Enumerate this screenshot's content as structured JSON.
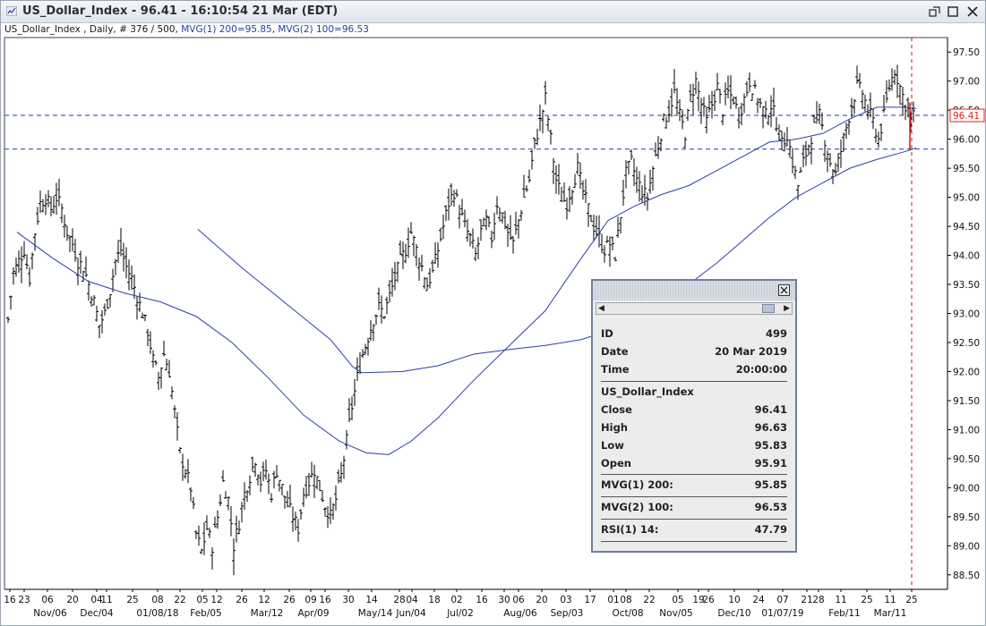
{
  "window": {
    "title": "US_Dollar_Index - 96.41 - 16:10:54  21 Mar (EDT)",
    "controls": [
      "restore-icon",
      "maximize-icon",
      "close-icon"
    ]
  },
  "info_line": {
    "instrument": "US_Dollar_Index , Daily, # 376 / 500, ",
    "mvg1": "MVG(1) 200=95.85",
    "separator": ", ",
    "mvg2": "MVG(2) 100=96.53"
  },
  "popup": {
    "rows": [
      {
        "key": "ID",
        "value": "499"
      },
      {
        "key": "Date",
        "value": "20 Mar 2019"
      },
      {
        "key": "Time",
        "value": "20:00:00"
      },
      {
        "key": "US_Dollar_Index",
        "value": ""
      },
      {
        "key": "Close",
        "value": "96.41"
      },
      {
        "key": "High",
        "value": "96.63"
      },
      {
        "key": "Low",
        "value": "95.83"
      },
      {
        "key": "Open",
        "value": "95.91"
      },
      {
        "key": "MVG(1) 200:",
        "value": "95.85"
      },
      {
        "key": "MVG(2) 100:",
        "value": "96.53"
      },
      {
        "key": "RSI(1) 14:",
        "value": "47.79"
      }
    ]
  },
  "chart_data": {
    "type": "ohlc",
    "ylim": [
      88.25,
      97.75
    ],
    "y_ticks": [
      "97.50",
      "97.00",
      "96.50",
      "96.00",
      "95.50",
      "95.00",
      "94.50",
      "94.00",
      "93.50",
      "93.00",
      "92.50",
      "92.00",
      "91.50",
      "91.00",
      "90.50",
      "90.00",
      "89.50",
      "89.00",
      "88.50"
    ],
    "last_price_label": "96.41",
    "last_price": 96.41,
    "h_lines": [
      96.41,
      95.83
    ],
    "x_day_labels": [
      "16",
      "23",
      "06",
      "20",
      "04",
      "11",
      "25",
      "08",
      "22",
      "05",
      "12",
      "26",
      "12",
      "26",
      "09",
      "16",
      "30",
      "14",
      "28",
      "04",
      "18",
      "02",
      "16",
      "30",
      "06",
      "20",
      "03",
      "17",
      "01",
      "08",
      "22",
      "05",
      "19",
      "26",
      "10",
      "24",
      "07",
      "21",
      "28",
      "11",
      "25",
      "11",
      "25"
    ],
    "x_month_labels": [
      "Nov/06",
      "Dec/04",
      "01/08/18",
      "Feb/05",
      "Mar/12",
      "Apr/09",
      "May/14",
      "Jun/04",
      "Jul/02",
      "Aug/06",
      "Sep/03",
      "Oct/08",
      "Nov/05",
      "Dec/10",
      "01/07/19",
      "Feb/11",
      "Mar/11"
    ],
    "colors": {
      "bars": "#000000",
      "ma": "#2d3fa6",
      "last_bar": "#e0201c",
      "label_box": "#e0201c",
      "dashed": "#2b3a9a",
      "axis": "#000000"
    },
    "series": [
      {
        "type": "ohlc_close_path",
        "points": [
          [
            0,
            92.9
          ],
          [
            6,
            93.7
          ],
          [
            12,
            93.9
          ],
          [
            18,
            94.1
          ],
          [
            24,
            93.6
          ],
          [
            30,
            94.4
          ],
          [
            36,
            94.9
          ],
          [
            42,
            95.0
          ],
          [
            48,
            94.8
          ],
          [
            54,
            95.0
          ],
          [
            60,
            94.8
          ],
          [
            66,
            94.4
          ],
          [
            72,
            94.2
          ],
          [
            78,
            93.9
          ],
          [
            84,
            93.8
          ],
          [
            90,
            93.5
          ],
          [
            96,
            93.2
          ],
          [
            102,
            92.8
          ],
          [
            108,
            93.0
          ],
          [
            114,
            93.4
          ],
          [
            120,
            93.9
          ],
          [
            126,
            94.1
          ],
          [
            132,
            93.8
          ],
          [
            138,
            93.6
          ],
          [
            144,
            93.3
          ],
          [
            150,
            93.0
          ],
          [
            156,
            92.7
          ],
          [
            162,
            92.2
          ],
          [
            168,
            91.9
          ],
          [
            174,
            92.3
          ],
          [
            180,
            92.0
          ],
          [
            186,
            91.3
          ],
          [
            192,
            90.6
          ],
          [
            198,
            90.3
          ],
          [
            204,
            90.0
          ],
          [
            210,
            89.2
          ],
          [
            216,
            88.9
          ],
          [
            222,
            89.3
          ],
          [
            228,
            89.0
          ],
          [
            234,
            89.5
          ],
          [
            240,
            90.1
          ],
          [
            246,
            89.8
          ],
          [
            252,
            89.0
          ],
          [
            258,
            89.4
          ],
          [
            264,
            89.9
          ],
          [
            270,
            90.2
          ],
          [
            276,
            90.5
          ],
          [
            282,
            90.1
          ],
          [
            288,
            90.3
          ],
          [
            294,
            89.9
          ],
          [
            300,
            90.3
          ],
          [
            306,
            90.0
          ],
          [
            312,
            89.7
          ],
          [
            318,
            89.5
          ],
          [
            324,
            89.3
          ],
          [
            330,
            89.9
          ],
          [
            336,
            90.1
          ],
          [
            342,
            90.3
          ],
          [
            348,
            90.0
          ],
          [
            354,
            89.7
          ],
          [
            360,
            89.5
          ],
          [
            366,
            89.8
          ],
          [
            372,
            90.2
          ],
          [
            378,
            90.8
          ],
          [
            384,
            91.4
          ],
          [
            390,
            91.9
          ],
          [
            396,
            92.3
          ],
          [
            402,
            92.6
          ],
          [
            408,
            92.9
          ],
          [
            414,
            93.1
          ],
          [
            420,
            93.0
          ],
          [
            426,
            93.3
          ],
          [
            432,
            93.6
          ],
          [
            438,
            93.9
          ],
          [
            444,
            94.1
          ],
          [
            450,
            94.4
          ],
          [
            456,
            94.1
          ],
          [
            462,
            93.8
          ],
          [
            468,
            93.5
          ],
          [
            474,
            93.7
          ],
          [
            480,
            94.1
          ],
          [
            486,
            94.5
          ],
          [
            492,
            94.9
          ],
          [
            498,
            95.1
          ],
          [
            504,
            94.8
          ],
          [
            510,
            94.5
          ],
          [
            516,
            94.3
          ],
          [
            522,
            94.0
          ],
          [
            528,
            94.4
          ],
          [
            534,
            94.6
          ],
          [
            540,
            94.3
          ],
          [
            546,
            94.9
          ],
          [
            552,
            94.7
          ],
          [
            558,
            94.4
          ],
          [
            564,
            94.2
          ],
          [
            570,
            94.6
          ],
          [
            576,
            95.0
          ],
          [
            582,
            95.3
          ],
          [
            588,
            95.9
          ],
          [
            594,
            96.3
          ],
          [
            600,
            96.7
          ],
          [
            606,
            96.0
          ],
          [
            612,
            95.3
          ],
          [
            618,
            95.0
          ],
          [
            624,
            94.9
          ],
          [
            630,
            95.2
          ],
          [
            636,
            95.5
          ],
          [
            642,
            95.1
          ],
          [
            648,
            94.8
          ],
          [
            654,
            94.5
          ],
          [
            660,
            94.3
          ],
          [
            666,
            94.1
          ],
          [
            672,
            94.2
          ],
          [
            678,
            94.0
          ],
          [
            684,
            94.7
          ],
          [
            690,
            95.4
          ],
          [
            696,
            95.6
          ],
          [
            702,
            95.3
          ],
          [
            708,
            95.1
          ],
          [
            714,
            95.0
          ],
          [
            720,
            95.5
          ],
          [
            726,
            95.9
          ],
          [
            732,
            96.3
          ],
          [
            738,
            96.5
          ],
          [
            744,
            96.8
          ],
          [
            750,
            96.4
          ],
          [
            756,
            96.1
          ],
          [
            762,
            96.7
          ],
          [
            768,
            97.0
          ],
          [
            774,
            96.6
          ],
          [
            780,
            96.3
          ],
          [
            786,
            96.6
          ],
          [
            792,
            96.9
          ],
          [
            798,
            96.5
          ],
          [
            804,
            96.8
          ],
          [
            810,
            96.7
          ],
          [
            816,
            96.4
          ],
          [
            822,
            96.7
          ],
          [
            828,
            97.0
          ],
          [
            834,
            96.8
          ],
          [
            840,
            96.6
          ],
          [
            846,
            96.4
          ],
          [
            852,
            96.6
          ],
          [
            858,
            96.3
          ],
          [
            864,
            95.9
          ],
          [
            870,
            96.1
          ],
          [
            876,
            95.6
          ],
          [
            882,
            95.2
          ],
          [
            888,
            95.6
          ],
          [
            894,
            95.9
          ],
          [
            900,
            96.2
          ],
          [
            906,
            96.4
          ],
          [
            912,
            96.0
          ],
          [
            918,
            95.6
          ],
          [
            924,
            95.4
          ],
          [
            930,
            95.8
          ],
          [
            936,
            96.2
          ],
          [
            942,
            96.6
          ],
          [
            948,
            96.9
          ],
          [
            954,
            96.8
          ],
          [
            960,
            96.5
          ],
          [
            966,
            96.3
          ],
          [
            972,
            96.0
          ],
          [
            978,
            96.4
          ],
          [
            984,
            96.9
          ],
          [
            990,
            97.2
          ],
          [
            996,
            96.9
          ],
          [
            1002,
            96.6
          ],
          [
            1008,
            96.4
          ],
          [
            1014,
            96.41
          ]
        ]
      },
      {
        "name": "MVG(1) 200",
        "type": "line",
        "points": [
          [
            212,
            94.45
          ],
          [
            260,
            93.8
          ],
          [
            320,
            93.05
          ],
          [
            360,
            92.55
          ],
          [
            385,
            92.08
          ],
          [
            395,
            91.98
          ],
          [
            440,
            92.0
          ],
          [
            480,
            92.1
          ],
          [
            520,
            92.3
          ],
          [
            560,
            92.38
          ],
          [
            600,
            92.45
          ],
          [
            640,
            92.55
          ],
          [
            670,
            92.7
          ],
          [
            700,
            92.95
          ],
          [
            730,
            93.2
          ],
          [
            760,
            93.5
          ],
          [
            790,
            93.85
          ],
          [
            820,
            94.25
          ],
          [
            850,
            94.65
          ],
          [
            880,
            95.0
          ],
          [
            910,
            95.25
          ],
          [
            940,
            95.5
          ],
          [
            970,
            95.65
          ],
          [
            1000,
            95.78
          ],
          [
            1014,
            95.85
          ]
        ]
      },
      {
        "name": "MVG(2) 100",
        "type": "line",
        "points": [
          [
            10,
            94.4
          ],
          [
            50,
            93.95
          ],
          [
            90,
            93.55
          ],
          [
            130,
            93.35
          ],
          [
            170,
            93.2
          ],
          [
            210,
            92.95
          ],
          [
            250,
            92.5
          ],
          [
            290,
            91.9
          ],
          [
            330,
            91.25
          ],
          [
            370,
            90.8
          ],
          [
            400,
            90.6
          ],
          [
            425,
            90.57
          ],
          [
            450,
            90.8
          ],
          [
            480,
            91.2
          ],
          [
            520,
            91.85
          ],
          [
            560,
            92.45
          ],
          [
            600,
            93.05
          ],
          [
            640,
            93.95
          ],
          [
            670,
            94.6
          ],
          [
            700,
            94.85
          ],
          [
            730,
            95.05
          ],
          [
            760,
            95.2
          ],
          [
            790,
            95.45
          ],
          [
            820,
            95.7
          ],
          [
            850,
            95.95
          ],
          [
            880,
            96.0
          ],
          [
            910,
            96.1
          ],
          [
            940,
            96.35
          ],
          [
            970,
            96.55
          ],
          [
            1000,
            96.55
          ],
          [
            1014,
            96.53
          ]
        ]
      }
    ]
  }
}
